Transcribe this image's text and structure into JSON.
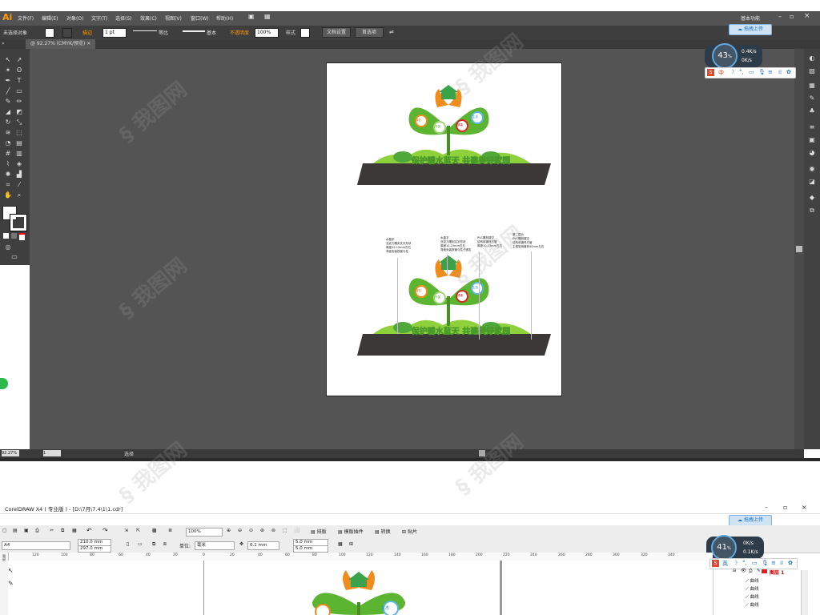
{
  "illustrator": {
    "logo": "Ai",
    "menu": [
      "文件(F)",
      "编辑(E)",
      "对象(O)",
      "文字(T)",
      "选择(S)",
      "效果(C)",
      "视图(V)",
      "窗口(W)",
      "帮助(H)"
    ],
    "workspace_label": "基本功能",
    "control": {
      "selection": "未选择对象",
      "stroke_label": "描边",
      "stroke_value": "1 pt",
      "profile_label": "等比",
      "brush_label": "基本",
      "opacity_label": "不透明度",
      "opacity_value": "100%",
      "style_label": "样式",
      "doc_setup": "文档设置",
      "preferences": "首选项"
    },
    "tab_title": "@ 92.27% (CMYK/预览)",
    "status_zoom": "92.27%",
    "status_page": "1",
    "status_tool": "选择",
    "artwork": {
      "banner_text": "保护碧水蓝天 共建美好家园",
      "bubbles": [
        "绿色",
        "环保",
        "健康",
        "生态"
      ]
    },
    "annotations": [
      "水晶字\n亚克力雕刻文字形状\n厚度12-15mm左右\n背面安装铁管与柱",
      "水晶字\n亚克力雕刻文字形状\n厚度10-15mm左右\n背面安装铁管与柱子固定",
      "PVC雕刻镂空\n结构用镀锌方管\n厚度10-15mm左右",
      "第二层为\nPVC雕刻镂空\n结构用镀锌方管\n主框架用镀锌40mm左右"
    ]
  },
  "monitor_top": {
    "percent": "43",
    "unit": "%",
    "up": "0.4K/s",
    "down": "0K/s",
    "upload": "拖拽上传"
  },
  "monitor_bottom": {
    "percent": "41",
    "unit": "%",
    "up": "0K/s",
    "down": "0.1K/s",
    "upload": "拖拽上传"
  },
  "ime": {
    "lang": "中",
    "lang2": "英"
  },
  "coreldraw": {
    "title": "CorelDRAW X4 ( 专业版 ) - [D:\\7月\\7.4\\1\\1.cdr]",
    "zoom": "100%",
    "paper": "A4",
    "width": "210.0 mm",
    "height": "297.0 mm",
    "units_label": "单位:",
    "units_value": "毫米",
    "nudge": "0.1 mm",
    "dup_x": "5.0 mm",
    "dup_y": "5.0 mm",
    "menu_buttons": [
      "排版",
      "模版插件",
      "转换",
      "贴片"
    ],
    "ruler_ticks": [
      "120",
      "100",
      "80",
      "60",
      "40",
      "20",
      "0",
      "20",
      "40",
      "60",
      "80",
      "100",
      "120",
      "140",
      "160",
      "180",
      "200",
      "220",
      "240",
      "260",
      "280",
      "300",
      "320",
      "340"
    ],
    "ruler_unit": "毫米",
    "layer_name": "图层 1",
    "objects": [
      "曲线",
      "曲线",
      "曲线",
      "曲线"
    ]
  },
  "colors": {
    "ai_bg": "#535353",
    "leaf_green": "#5cb531",
    "orange": "#f08c1e",
    "base_dark": "#3d3838",
    "accent": "#1b6fc4"
  }
}
